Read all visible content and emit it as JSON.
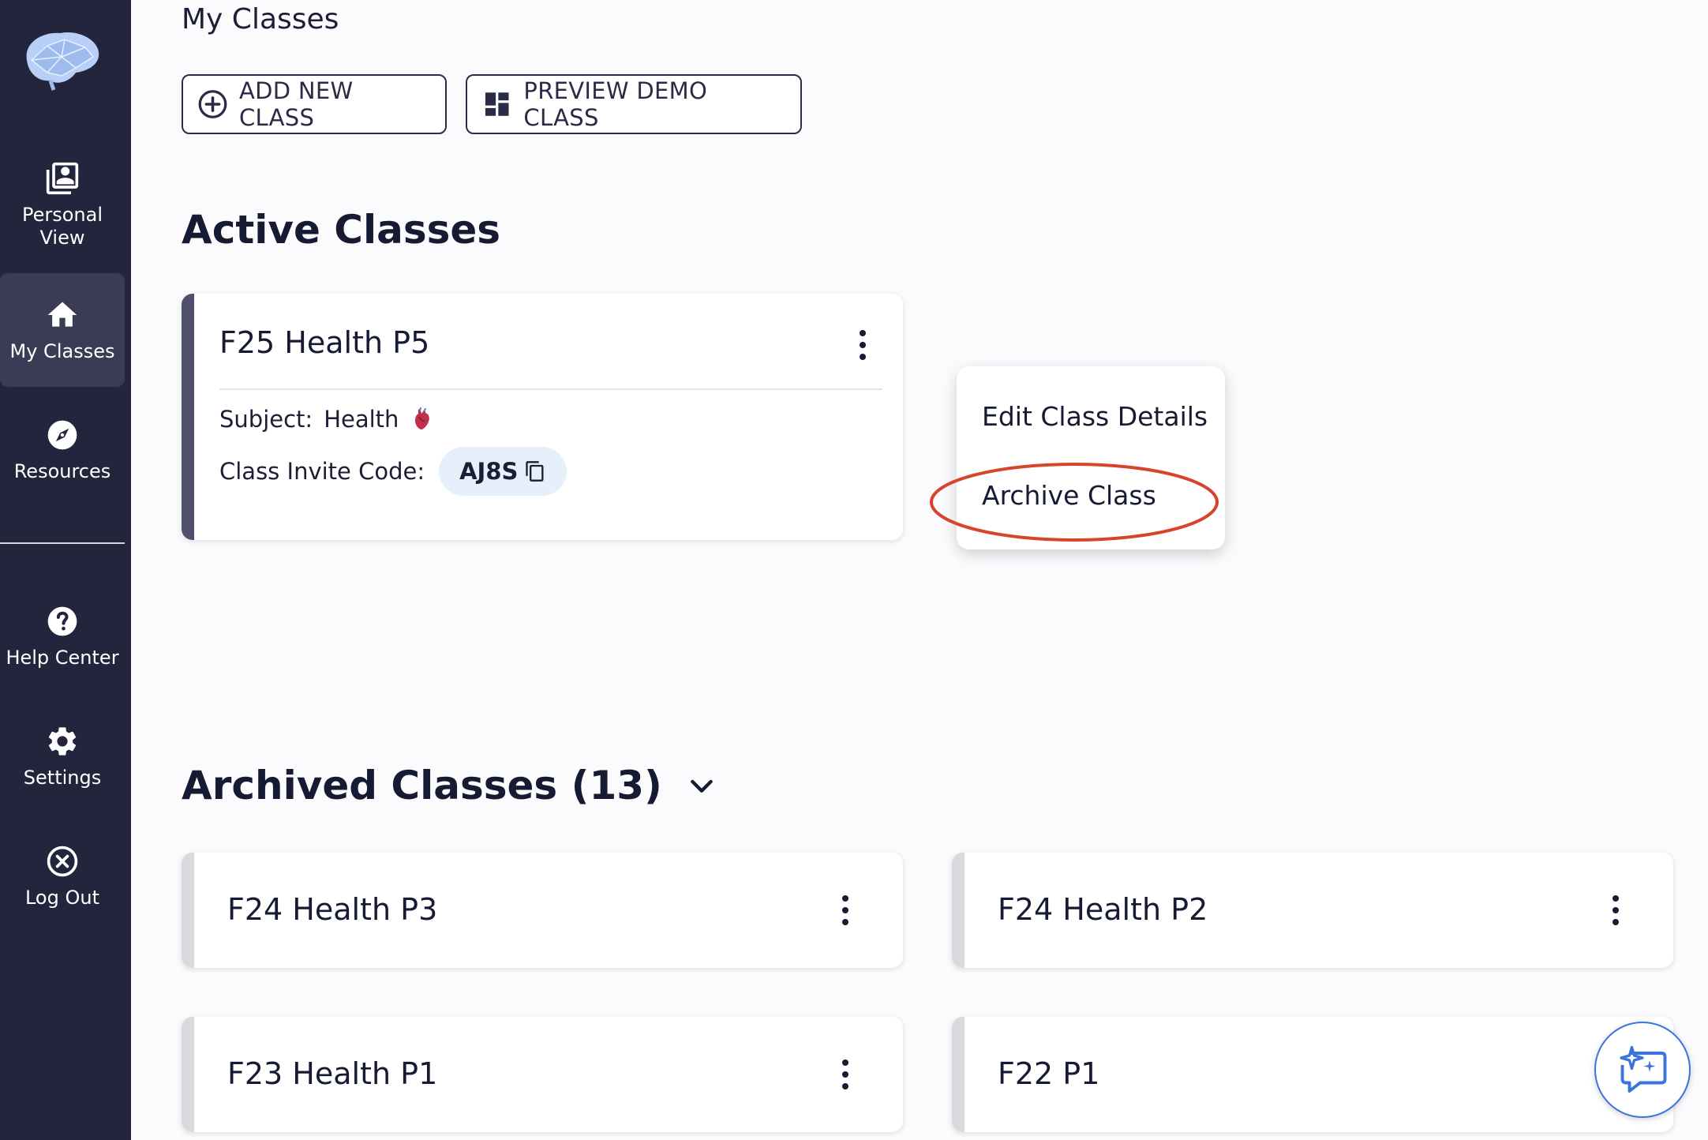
{
  "sidebar": {
    "logo_icon": "brain-logo",
    "items": [
      {
        "label": "Personal View",
        "icon": "portrait-stack-icon"
      },
      {
        "label": "My Classes",
        "icon": "home-icon",
        "active": true
      },
      {
        "label": "Resources",
        "icon": "compass-icon"
      },
      {
        "label": "Help Center",
        "icon": "help-icon"
      },
      {
        "label": "Settings",
        "icon": "gear-icon"
      },
      {
        "label": "Log Out",
        "icon": "close-circle-icon"
      }
    ]
  },
  "header": {
    "title": "My Classes",
    "add_button": "ADD NEW CLASS",
    "demo_button": "PREVIEW DEMO CLASS"
  },
  "active": {
    "title": "Active Classes",
    "card": {
      "name": "F25 Health P5",
      "subject_label": "Subject:",
      "subject_value": "Health",
      "code_label": "Class Invite Code:",
      "code_value": "AJ8S"
    },
    "menu": {
      "edit": "Edit Class Details",
      "archive": "Archive Class"
    }
  },
  "archived": {
    "title": "Archived Classes (13)",
    "classes": [
      "F24 Health P3",
      "F24 Health P2",
      "F23 Health P1",
      "F22 P1"
    ]
  },
  "colors": {
    "sidebar_bg": "#23253d",
    "active_nav_bg": "#3a3c56",
    "accent_border": "#4d4f6b",
    "annotation_red": "#d8432c",
    "chat_blue": "#3b74db",
    "code_pill_bg": "#e6f0fb"
  }
}
